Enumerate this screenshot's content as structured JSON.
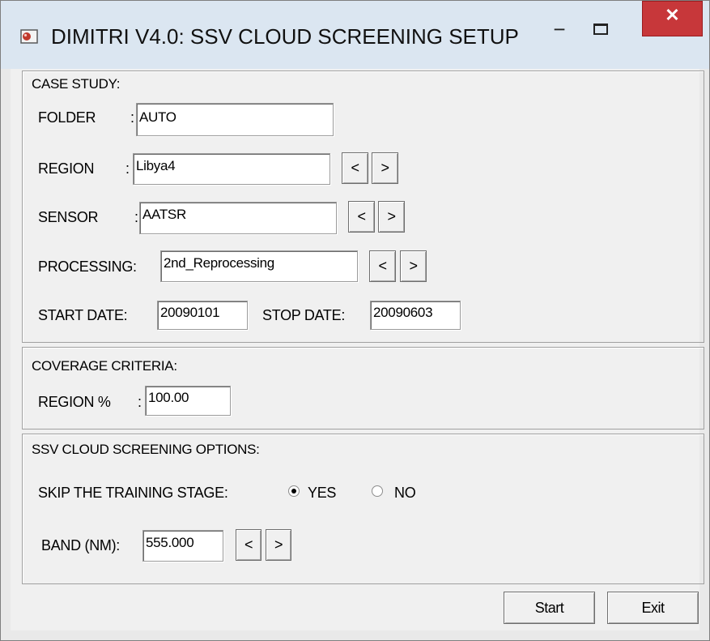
{
  "window": {
    "title": "DIMITRI V4.0: SSV CLOUD SCREENING SETUP",
    "minimize_glyph": "−",
    "close_glyph": "✕",
    "icon": "app-icon"
  },
  "case_study": {
    "title": "CASE STUDY:",
    "folder": {
      "label": "FOLDER",
      "sep": ":",
      "value": "AUTO"
    },
    "region": {
      "label": "REGION",
      "sep": ":",
      "value": "Libya4",
      "prev": "<",
      "next": ">"
    },
    "sensor": {
      "label": "SENSOR",
      "sep": ":",
      "value": "AATSR",
      "prev": "<",
      "next": ">"
    },
    "processing": {
      "label": "PROCESSING:",
      "value": "2nd_Reprocessing",
      "prev": "<",
      "next": ">"
    },
    "start_date": {
      "label": "START DATE:",
      "value": "20090101"
    },
    "stop_date": {
      "label": "STOP DATE:",
      "value": "20090603"
    }
  },
  "coverage": {
    "title": "COVERAGE CRITERIA:",
    "region_pct": {
      "label": "REGION %",
      "sep": ":",
      "value": "100.00"
    }
  },
  "ssv": {
    "title": "SSV CLOUD SCREENING OPTIONS:",
    "skip_label": "SKIP THE TRAINING STAGE:",
    "yes_label": "YES",
    "no_label": "NO",
    "selected": "YES",
    "band": {
      "label": "BAND (NM):",
      "value": "555.000",
      "prev": "<",
      "next": ">"
    }
  },
  "buttons": {
    "start": "Start",
    "exit": "Exit"
  },
  "colors": {
    "close_button": "#c7373a",
    "titlebar": "#dbe6f1",
    "client": "#f0f0f0"
  }
}
